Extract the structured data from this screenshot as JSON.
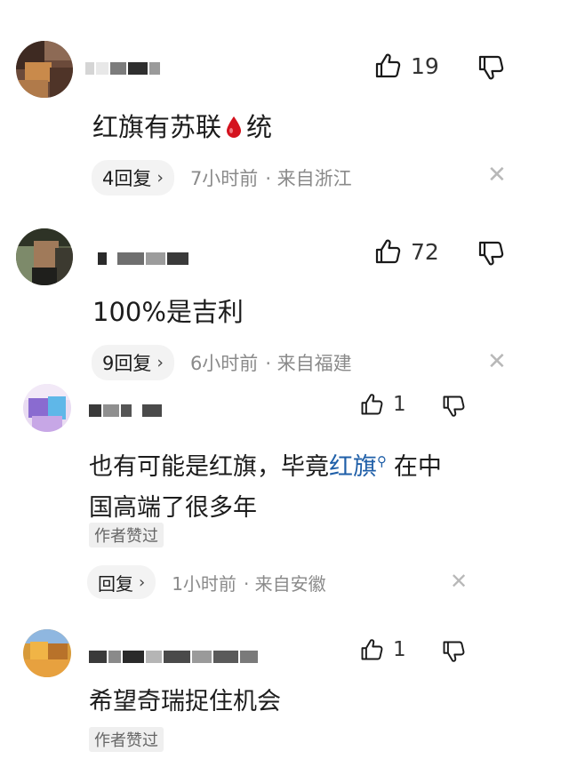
{
  "colors": {
    "link": "#1f5fa8",
    "meta_gray": "#8a8a8a",
    "pill_bg": "#f3f3f3",
    "blood_red": "#d4121e"
  },
  "comments": [
    {
      "text_before": "红旗有苏联",
      "emoji": "blood-drop",
      "text_after": "统",
      "likes": "19",
      "reply_label": "4回复",
      "time": "7小时前",
      "location": "· 来自浙江"
    },
    {
      "text": "100%是吉利",
      "likes": "72",
      "reply_label": "9回复",
      "time": "6小时前",
      "location": "· 来自福建"
    },
    {
      "text_before": "也有可能是红旗，毕竟",
      "link": "红旗",
      "text_after": "在中",
      "text_line2": "国高端了很多年",
      "likes": "1",
      "badge": "作者赞过",
      "reply_label": "回复",
      "time": "1小时前",
      "location": "· 来自安徽"
    },
    {
      "text": "希望奇瑞捉住机会",
      "likes": "1",
      "badge": "作者赞过"
    }
  ]
}
